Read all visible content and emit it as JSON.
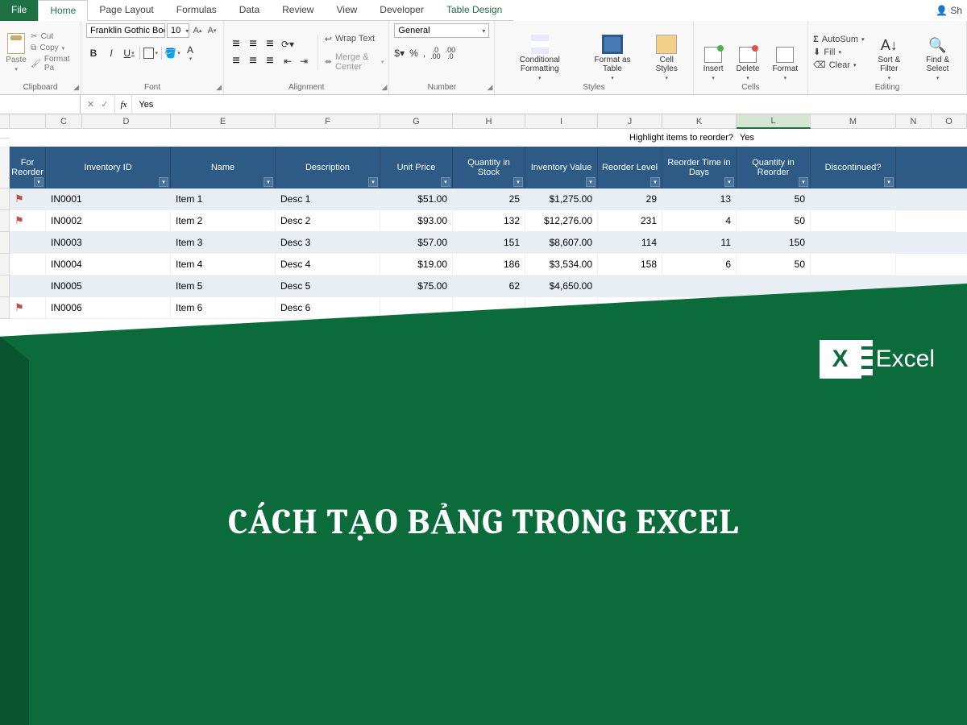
{
  "tabs": {
    "file": "File",
    "home": "Home",
    "page_layout": "Page Layout",
    "formulas": "Formulas",
    "data": "Data",
    "review": "Review",
    "view": "View",
    "developer": "Developer",
    "table_design": "Table Design",
    "share": "Sh"
  },
  "ribbon": {
    "clipboard": {
      "paste": "Paste",
      "cut": "Cut",
      "copy": "Copy",
      "format_painter": "Format Pa",
      "label": "Clipboard"
    },
    "font": {
      "name": "Franklin Gothic Boo",
      "size": "10",
      "bold": "B",
      "italic": "I",
      "underline": "U",
      "label": "Font"
    },
    "alignment": {
      "wrap": "Wrap Text",
      "merge": "Merge & Center",
      "label": "Alignment"
    },
    "number": {
      "format": "General",
      "label": "Number"
    },
    "styles": {
      "cf": "Conditional Formatting",
      "fat": "Format as Table",
      "cs": "Cell Styles",
      "label": "Styles"
    },
    "cells": {
      "insert": "Insert",
      "delete": "Delete",
      "format": "Format",
      "label": "Cells"
    },
    "editing": {
      "autosum": "AutoSum",
      "fill": "Fill",
      "clear": "Clear",
      "sort": "Sort & Filter",
      "find": "Find & Select",
      "label": "Editing"
    }
  },
  "formula_bar": {
    "name_box": "",
    "fx": "fx",
    "value": "Yes"
  },
  "columns": [
    "C",
    "D",
    "E",
    "F",
    "G",
    "H",
    "I",
    "J",
    "K",
    "L",
    "M",
    "N",
    "O"
  ],
  "helper": {
    "text": "Highlight items to reorder?",
    "value": "Yes"
  },
  "table": {
    "headers": [
      "For Reorder",
      "Inventory ID",
      "Name",
      "Description",
      "Unit Price",
      "Quantity in Stock",
      "Inventory Value",
      "Reorder Level",
      "Reorder Time in Days",
      "Quantity in Reorder",
      "Discontinued?"
    ],
    "rows": [
      {
        "flag": true,
        "id": "IN0001",
        "name": "Item 1",
        "desc": "Desc 1",
        "price": "$51.00",
        "qty": "25",
        "val": "$1,275.00",
        "rl": "29",
        "rtd": "13",
        "qir": "50",
        "disc": ""
      },
      {
        "flag": true,
        "id": "IN0002",
        "name": "Item 2",
        "desc": "Desc 2",
        "price": "$93.00",
        "qty": "132",
        "val": "$12,276.00",
        "rl": "231",
        "rtd": "4",
        "qir": "50",
        "disc": ""
      },
      {
        "flag": false,
        "id": "IN0003",
        "name": "Item 3",
        "desc": "Desc 3",
        "price": "$57.00",
        "qty": "151",
        "val": "$8,607.00",
        "rl": "114",
        "rtd": "11",
        "qir": "150",
        "disc": ""
      },
      {
        "flag": false,
        "id": "IN0004",
        "name": "Item 4",
        "desc": "Desc 4",
        "price": "$19.00",
        "qty": "186",
        "val": "$3,534.00",
        "rl": "158",
        "rtd": "6",
        "qir": "50",
        "disc": ""
      },
      {
        "flag": false,
        "id": "IN0005",
        "name": "Item 5",
        "desc": "Desc 5",
        "price": "$75.00",
        "qty": "62",
        "val": "$4,650.00",
        "rl": "",
        "rtd": "",
        "qir": "",
        "disc": ""
      },
      {
        "flag": true,
        "id": "IN0006",
        "name": "Item 6",
        "desc": "Desc 6",
        "price": "",
        "qty": "",
        "val": "",
        "rl": "",
        "rtd": "",
        "qir": "",
        "disc": ""
      }
    ]
  },
  "overlay": {
    "brand": "Excel",
    "title": "CÁCH TẠO BẢNG TRONG EXCEL"
  }
}
